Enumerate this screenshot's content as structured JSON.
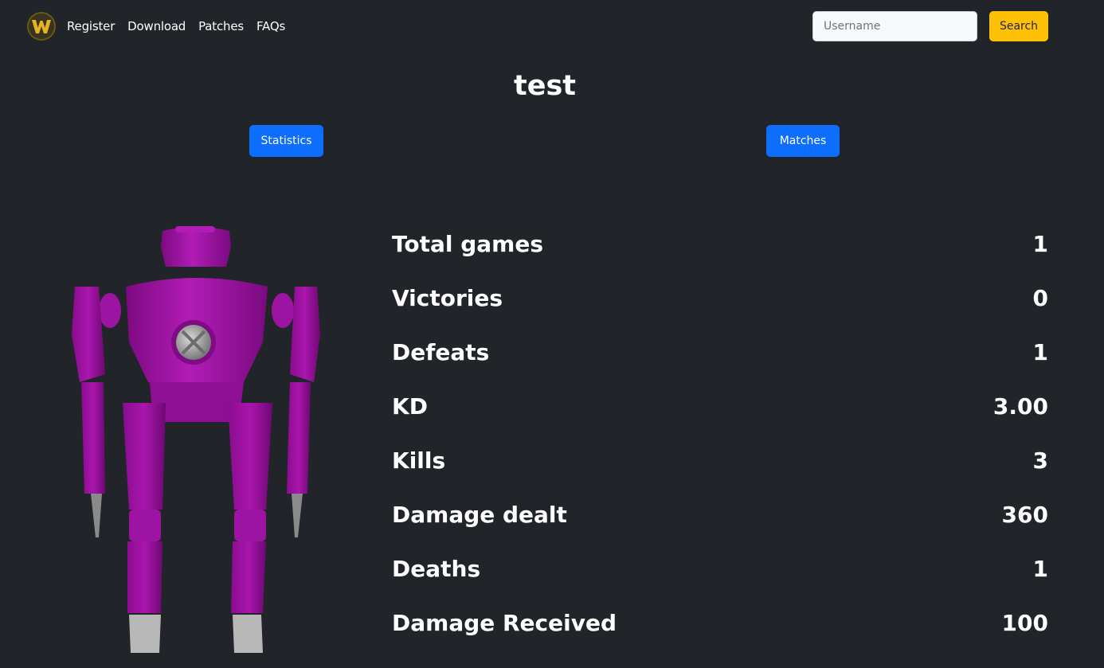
{
  "nav": {
    "links": [
      "Register",
      "Download",
      "Patches",
      "FAQs"
    ]
  },
  "search": {
    "placeholder": "Username",
    "button_label": "Search"
  },
  "profile": {
    "username": "test"
  },
  "tabs": {
    "statistics_label": "Statistics",
    "matches_label": "Matches"
  },
  "stats": [
    {
      "label": "Total games",
      "value": "1"
    },
    {
      "label": "Victories",
      "value": "0"
    },
    {
      "label": "Defeats",
      "value": "1"
    },
    {
      "label": "KD",
      "value": "3.00"
    },
    {
      "label": "Kills",
      "value": "3"
    },
    {
      "label": "Damage dealt",
      "value": "360"
    },
    {
      "label": "Deaths",
      "value": "1"
    },
    {
      "label": "Damage Received",
      "value": "100"
    }
  ],
  "colors": {
    "background": "#212529",
    "accent_primary": "#0d6efd",
    "accent_warning": "#ffc107",
    "robot_body": "#a114a6"
  }
}
